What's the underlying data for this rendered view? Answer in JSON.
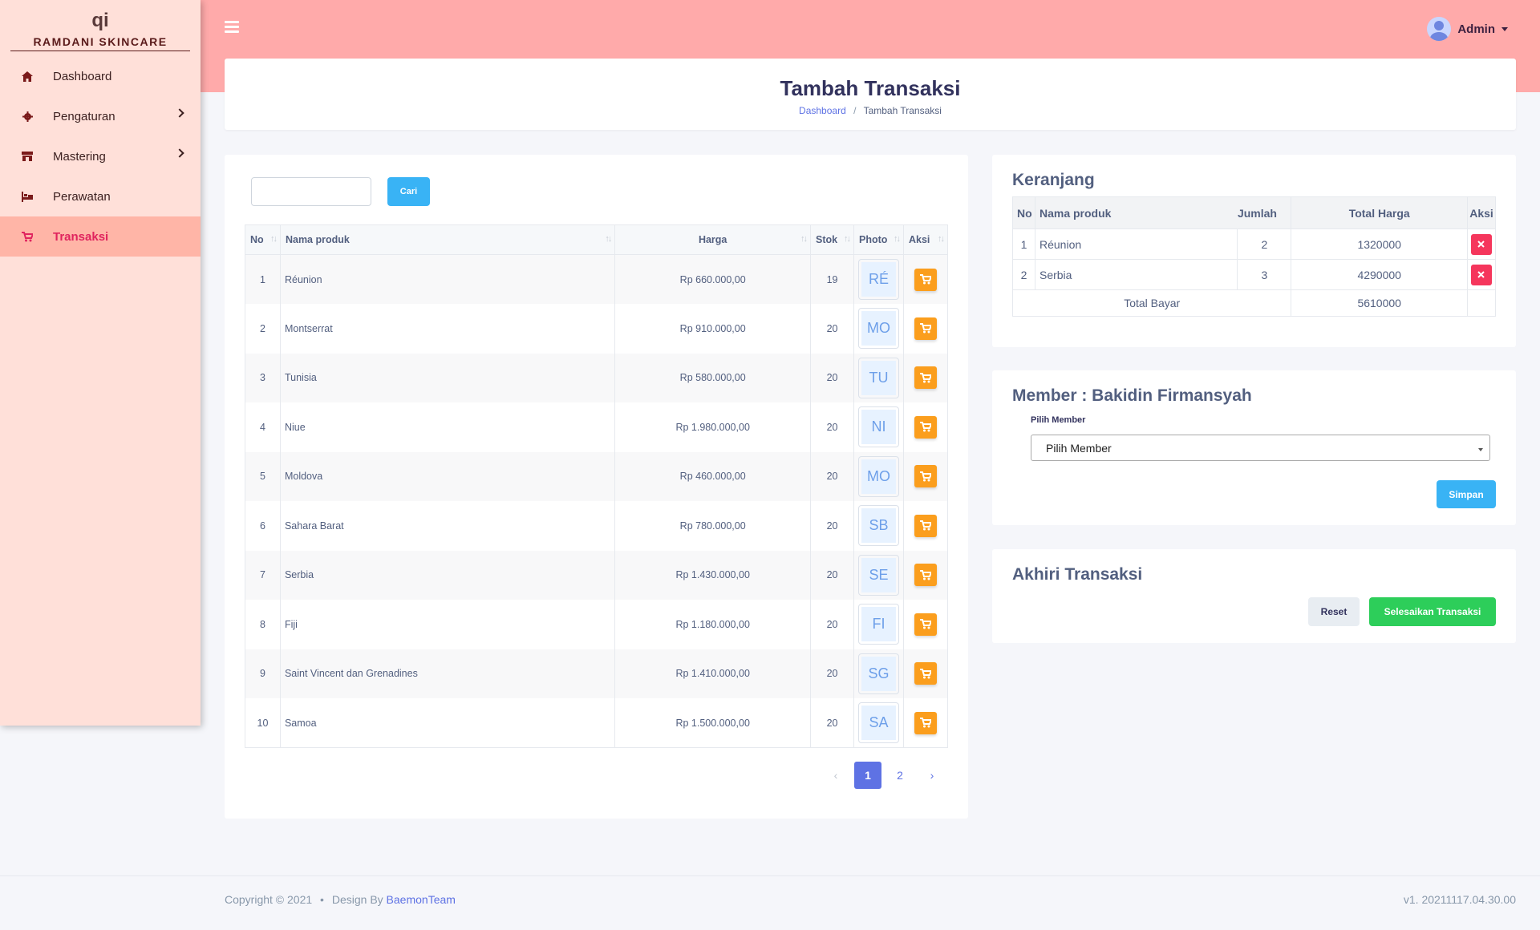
{
  "brand": {
    "logo": "qi",
    "name": "RAMDANI SKINCARE"
  },
  "sidebar": {
    "items": [
      {
        "label": "Dashboard",
        "icon": "home-icon"
      },
      {
        "label": "Pengaturan",
        "icon": "gear-icon"
      },
      {
        "label": "Mastering",
        "icon": "store-icon"
      },
      {
        "label": "Perawatan",
        "icon": "spa-icon"
      },
      {
        "label": "Transaksi",
        "icon": "cart-icon"
      }
    ],
    "active": "Transaksi"
  },
  "topbar": {
    "user": "Admin"
  },
  "header": {
    "title": "Tambah Transaksi",
    "breadcrumb": {
      "home": "Dashboard",
      "separator": "/",
      "current": "Tambah Transaksi"
    }
  },
  "products": {
    "search_button": "Cari",
    "columns": [
      "No",
      "Nama produk",
      "Harga",
      "Stok",
      "Photo",
      "Aksi"
    ],
    "rows": [
      {
        "no": "1",
        "name": "Réunion",
        "price": "Rp 660.000,00",
        "stock": "19",
        "photo": "RÉ"
      },
      {
        "no": "2",
        "name": "Montserrat",
        "price": "Rp 910.000,00",
        "stock": "20",
        "photo": "MO"
      },
      {
        "no": "3",
        "name": "Tunisia",
        "price": "Rp 580.000,00",
        "stock": "20",
        "photo": "TU"
      },
      {
        "no": "4",
        "name": "Niue",
        "price": "Rp 1.980.000,00",
        "stock": "20",
        "photo": "NI"
      },
      {
        "no": "5",
        "name": "Moldova",
        "price": "Rp 460.000,00",
        "stock": "20",
        "photo": "MO"
      },
      {
        "no": "6",
        "name": "Sahara Barat",
        "price": "Rp 780.000,00",
        "stock": "20",
        "photo": "SB"
      },
      {
        "no": "7",
        "name": "Serbia",
        "price": "Rp 1.430.000,00",
        "stock": "20",
        "photo": "SE"
      },
      {
        "no": "8",
        "name": "Fiji",
        "price": "Rp 1.180.000,00",
        "stock": "20",
        "photo": "FI"
      },
      {
        "no": "9",
        "name": "Saint Vincent dan Grenadines",
        "price": "Rp 1.410.000,00",
        "stock": "20",
        "photo": "SG"
      },
      {
        "no": "10",
        "name": "Samoa",
        "price": "Rp 1.500.000,00",
        "stock": "20",
        "photo": "SA"
      }
    ],
    "pagination": {
      "prev": "‹",
      "pages": [
        "1",
        "2"
      ],
      "current": "1",
      "next": "›"
    }
  },
  "cart": {
    "title": "Keranjang",
    "columns": [
      "No",
      "Nama produk",
      "Jumlah",
      "Total Harga",
      "Aksi"
    ],
    "rows": [
      {
        "no": "1",
        "name": "Réunion",
        "qty": "2",
        "total": "1320000"
      },
      {
        "no": "2",
        "name": "Serbia",
        "qty": "3",
        "total": "4290000"
      }
    ],
    "total_label": "Total Bayar",
    "total_value": "5610000"
  },
  "member": {
    "title": "Member : Bakidin Firmansyah",
    "select_label": "Pilih Member",
    "select_value": "Pilih Member",
    "save_button": "Simpan"
  },
  "akhiri": {
    "title": "Akhiri Transaksi",
    "reset_button": "Reset",
    "finish_button": "Selesaikan Transaksi"
  },
  "footer": {
    "copyright": "Copyright © 2021",
    "bullet": "•",
    "design_by": "Design By",
    "team": "BaemonTeam",
    "version": "v1. 20211117.04.30.00"
  },
  "colors": {
    "topbar": "#ffaaaa",
    "sidebar": "#ffe0d9",
    "active": "#e0245e",
    "primary": "#5e72e4"
  }
}
